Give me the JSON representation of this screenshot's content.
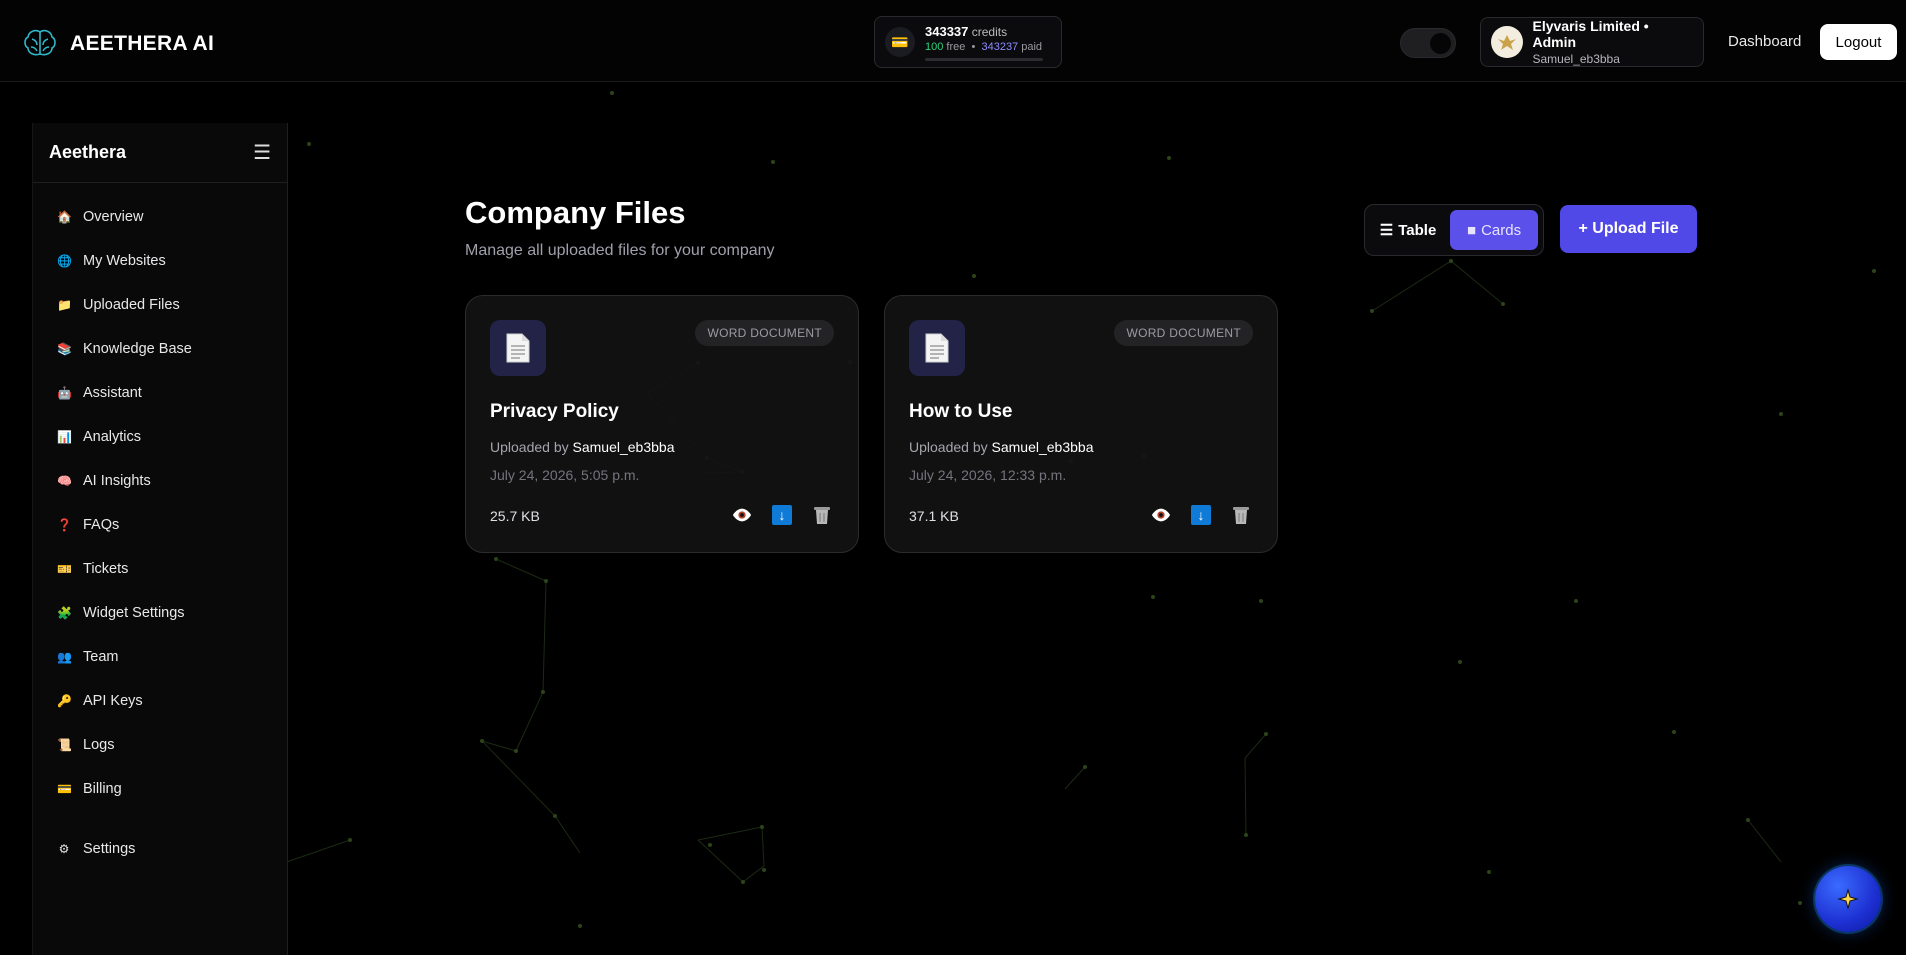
{
  "header": {
    "brand": "AEETHERA AI",
    "credits": {
      "total": "343337",
      "label": "credits",
      "free": "100",
      "free_label": "free",
      "paid": "343237",
      "paid_label": "paid"
    },
    "user": {
      "name": "Elyvaris Limited • Admin",
      "username": "Samuel_eb3bba"
    },
    "nav_dashboard": "Dashboard",
    "logout": "Logout"
  },
  "sidebar": {
    "title": "Aeethera",
    "items": [
      {
        "label": "Overview",
        "icon": "🏠"
      },
      {
        "label": "My Websites",
        "icon": "🌐"
      },
      {
        "label": "Uploaded Files",
        "icon": "📁"
      },
      {
        "label": "Knowledge Base",
        "icon": "📚"
      },
      {
        "label": "Assistant",
        "icon": "🤖"
      },
      {
        "label": "Analytics",
        "icon": "📊"
      },
      {
        "label": "AI Insights",
        "icon": "🧠"
      },
      {
        "label": "FAQs",
        "icon": "❓"
      },
      {
        "label": "Tickets",
        "icon": "🎫"
      },
      {
        "label": "Widget Settings",
        "icon": "🧩"
      },
      {
        "label": "Team",
        "icon": "👥"
      },
      {
        "label": "API Keys",
        "icon": "🔑"
      },
      {
        "label": "Logs",
        "icon": "📜"
      },
      {
        "label": "Billing",
        "icon": "💳"
      },
      {
        "label": "Settings",
        "icon": "⚙"
      }
    ]
  },
  "main": {
    "title": "Company Files",
    "subtitle": "Manage all uploaded files for your company",
    "view_table": "Table",
    "view_cards": "Cards",
    "upload": "+ Upload File",
    "uploaded_by_label": "Uploaded by",
    "files": [
      {
        "name": "Privacy Policy",
        "type": "WORD DOCUMENT",
        "uploaded_by": "Samuel_eb3bba",
        "date": "July 24, 2026, 5:05 p.m.",
        "size": "25.7 KB"
      },
      {
        "name": "How to Use",
        "type": "WORD DOCUMENT",
        "uploaded_by": "Samuel_eb3bba",
        "date": "July 24, 2026, 12:33 p.m.",
        "size": "37.1 KB"
      }
    ]
  },
  "colors": {
    "accent": "#5148e8",
    "background": "#000000",
    "free_green": "#2fd27a",
    "paid_purple": "#8e8cff"
  }
}
